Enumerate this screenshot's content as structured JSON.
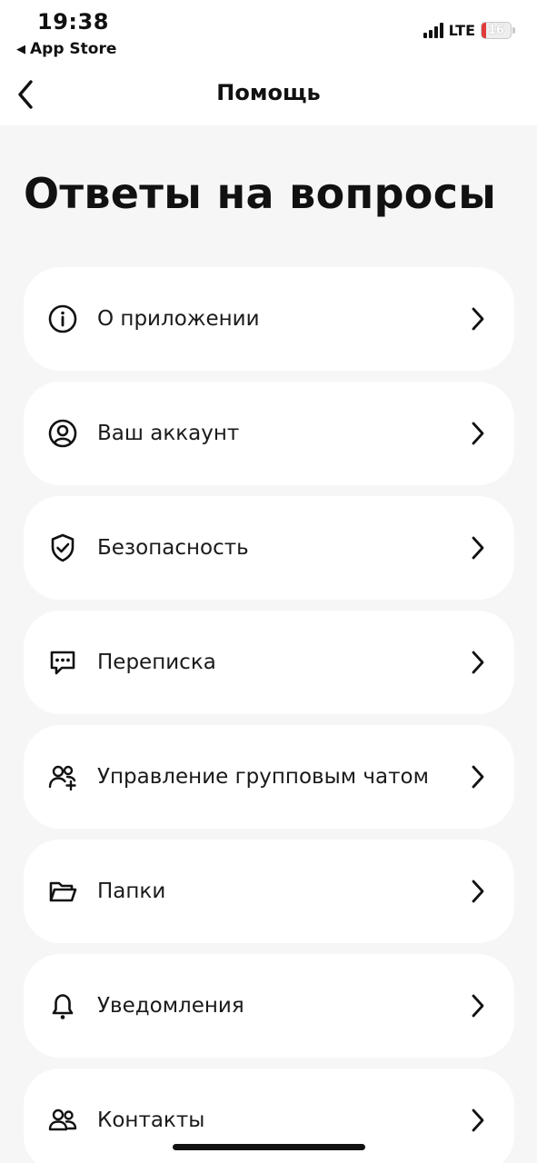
{
  "status_bar": {
    "time": "19:38",
    "back_app": "App Store",
    "network": "LTE",
    "battery": "16"
  },
  "nav": {
    "title": "Помощь"
  },
  "page": {
    "heading": "Ответы на вопросы"
  },
  "items": [
    {
      "label": "О приложении",
      "icon": "info-icon"
    },
    {
      "label": "Ваш аккаунт",
      "icon": "user-circle-icon"
    },
    {
      "label": "Безопасность",
      "icon": "shield-check-icon"
    },
    {
      "label": "Переписка",
      "icon": "chat-bubble-icon"
    },
    {
      "label": "Управление групповым чатом",
      "icon": "group-add-icon"
    },
    {
      "label": "Папки",
      "icon": "folder-icon"
    },
    {
      "label": "Уведомления",
      "icon": "bell-icon"
    },
    {
      "label": "Контакты",
      "icon": "contacts-icon"
    }
  ],
  "colors": {
    "background": "#f6f6f6",
    "card": "#ffffff",
    "text": "#111111",
    "battery_low": "#e03b3b"
  }
}
